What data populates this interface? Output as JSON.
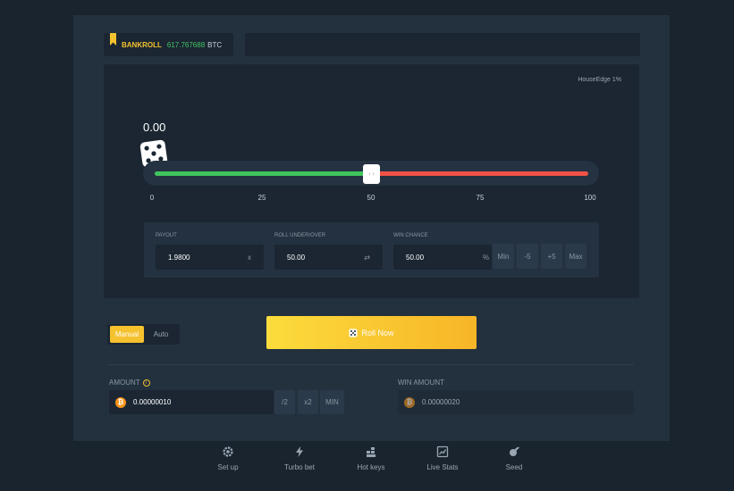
{
  "bankroll": {
    "label": "BANKROLL",
    "value": "617.767688",
    "currency": "BTC"
  },
  "house_edge": "HouseEdge 1%",
  "result": "0.00",
  "slider": {
    "value": 50,
    "ticks": [
      "0",
      "25",
      "50",
      "75",
      "100"
    ],
    "handle_glyph": "‹ ›",
    "colors": {
      "under": "#3fc55b",
      "over": "#ef5346"
    }
  },
  "controls": {
    "payout": {
      "label": "PAYOUT",
      "value": "1.9800",
      "suffix": "x"
    },
    "roll": {
      "label": "ROLL UNDER/OVER",
      "value": "50.00",
      "swap_icon": "⇄"
    },
    "win_chance": {
      "label": "WIN CHANCE",
      "value": "50.00",
      "suffix": "%"
    },
    "buttons": [
      "Min",
      "-5",
      "+5",
      "Max"
    ]
  },
  "mode": {
    "manual": "Manual",
    "auto": "Auto"
  },
  "roll_button": {
    "label": "Roll Now"
  },
  "amount": {
    "label": "AMOUNT",
    "info": "i",
    "value": "0.00000010",
    "buttons": [
      "/2",
      "x2",
      "MIN"
    ]
  },
  "win_amount": {
    "label": "WIN AMOUNT",
    "value": "0.00000020"
  },
  "btc_symbol": "₿",
  "footer": [
    {
      "label": "Set up",
      "icon": "gear-icon"
    },
    {
      "label": "Turbo bet",
      "icon": "lightning-icon"
    },
    {
      "label": "Hot keys",
      "icon": "keyboard-icon"
    },
    {
      "label": "Live Stats",
      "icon": "chart-icon"
    },
    {
      "label": "Seed",
      "icon": "seed-icon"
    }
  ],
  "colors": {
    "accent": "#f5c12e",
    "bank_value": "#43c664",
    "btc": "#f7931a"
  }
}
